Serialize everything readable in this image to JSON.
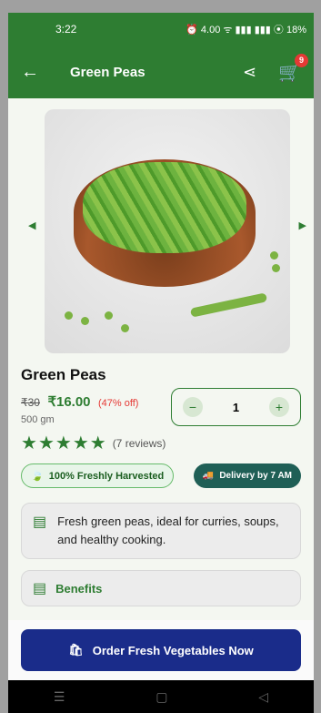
{
  "status": {
    "time": "3:22",
    "indicators": "⏰ 4.00 ᯤ ▮▮▮ ▮▮▮ ⦿ 18%"
  },
  "appbar": {
    "title": "Green Peas",
    "cart_count": "9"
  },
  "product": {
    "name": "Green Peas",
    "old_price": "₹30",
    "price": "₹16.00",
    "discount": "(47% off)",
    "weight": "500 gm",
    "quantity": "1",
    "rating": 5,
    "reviews": "(7 reviews)",
    "chip_harvest": "100% Freshly Harvested",
    "chip_delivery": "Delivery by 7 AM",
    "description": "Fresh green peas, ideal for curries, soups, and healthy cooking.",
    "benefits_label": "Benefits"
  },
  "cta": {
    "label": "Order Fresh Vegetables Now"
  },
  "colors": {
    "primary": "#2e7d32",
    "cta": "#1a2c8a",
    "discount": "#e53935"
  }
}
